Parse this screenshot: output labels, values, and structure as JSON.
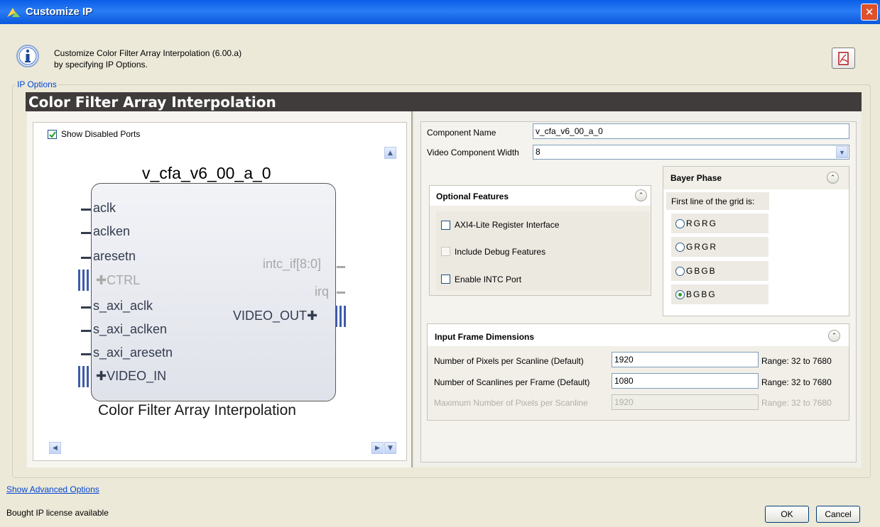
{
  "window": {
    "title": "Customize IP",
    "close_glyph": "✕"
  },
  "description": {
    "line1": "Customize Color Filter Array Interpolation (6.00.a)",
    "line2": "by specifying IP Options."
  },
  "section_label": "IP Options",
  "header_title": "Color Filter Array Interpolation",
  "left": {
    "show_disabled_ports": {
      "label": "Show Disabled Ports",
      "checked": true
    },
    "diagram": {
      "instance_name": "v_cfa_v6_00_a_0",
      "caption": "Color Filter Array Interpolation",
      "left_ports": [
        "aclk",
        "aclken",
        "aresetn",
        "CTRL",
        "s_axi_aclk",
        "s_axi_aclken",
        "s_axi_aresetn",
        "VIDEO_IN"
      ],
      "right_ports": [
        "intc_if[8:0]",
        "irq",
        "VIDEO_OUT"
      ]
    }
  },
  "right": {
    "component_name": {
      "label": "Component Name",
      "value": "v_cfa_v6_00_a_0"
    },
    "video_width": {
      "label": "Video Component Width",
      "value": "8"
    },
    "optional_features": {
      "title": "Optional Features",
      "items": [
        "AXI4-Lite Register Interface",
        "Include Debug Features",
        "Enable INTC Port"
      ]
    },
    "bayer_phase": {
      "title": "Bayer Phase",
      "prompt": "First line of the grid is:",
      "options": [
        "RGRG",
        "GRGR",
        "GBGB",
        "BGBG"
      ],
      "selected": "BGBG"
    },
    "input_frame": {
      "title": "Input Frame Dimensions",
      "rows": [
        {
          "label": "Number of Pixels per Scanline (Default)",
          "value": "1920",
          "range": "Range: 32 to 7680",
          "enabled": true
        },
        {
          "label": "Number of Scanlines per Frame (Default)",
          "value": "1080",
          "range": "Range: 32 to 7680",
          "enabled": true
        },
        {
          "label": "Maximum Number of Pixels per Scanline",
          "value": "1920",
          "range": "Range: 32 to 7680",
          "enabled": false
        }
      ]
    }
  },
  "footer": {
    "advanced_link": "Show Advanced Options",
    "license_status": "Bought IP license available",
    "ok_label": "OK",
    "cancel_label": "Cancel"
  }
}
